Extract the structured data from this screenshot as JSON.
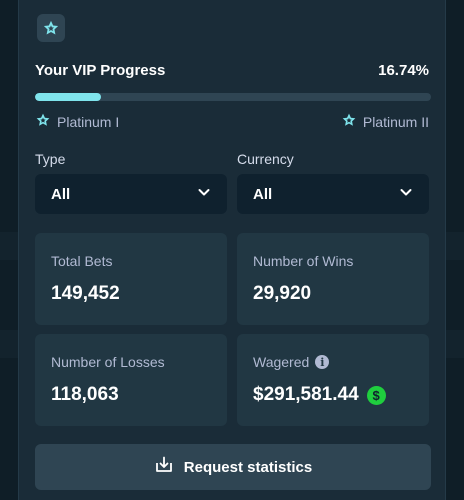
{
  "vip": {
    "title": "Your VIP Progress",
    "percent_label": "16.74%",
    "progress": 0.1674,
    "current_tier": "Platinum I",
    "next_tier": "Platinum II",
    "badge_icon": "star-icon",
    "accent_color": "#7fe4ec"
  },
  "filters": {
    "type": {
      "label": "Type",
      "value": "All"
    },
    "currency": {
      "label": "Currency",
      "value": "All"
    }
  },
  "stats": {
    "total_bets": {
      "label": "Total Bets",
      "value": "149,452"
    },
    "wins": {
      "label": "Number of Wins",
      "value": "29,920"
    },
    "losses": {
      "label": "Number of Losses",
      "value": "118,063"
    },
    "wagered": {
      "label": "Wagered",
      "value": "$291,581.44",
      "currency_icon": "dollar-coin-icon",
      "currency_color": "#1fce3e"
    }
  },
  "actions": {
    "request_label": "Request statistics"
  }
}
